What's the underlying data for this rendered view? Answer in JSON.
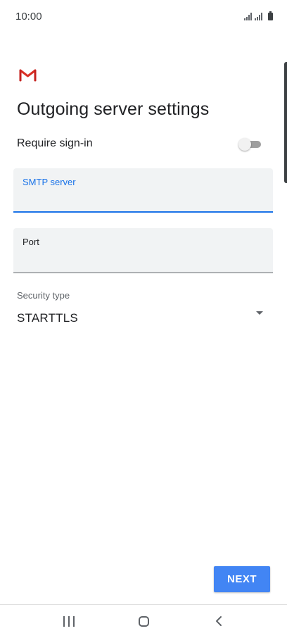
{
  "status_bar": {
    "time": "10:00",
    "icons": [
      "signal-icon",
      "signal-icon",
      "battery-icon"
    ]
  },
  "app": {
    "logo": "gmail-icon",
    "colors": {
      "accent": "#1a73e8",
      "button": "#4285f4",
      "gmail_red": "#d93025"
    }
  },
  "page": {
    "title": "Outgoing server settings"
  },
  "require_signin": {
    "label": "Require sign-in",
    "enabled": false
  },
  "smtp_field": {
    "label": "SMTP server",
    "value": "",
    "focused": true
  },
  "port_field": {
    "label": "Port",
    "value": ""
  },
  "security": {
    "label": "Security type",
    "value": "STARTTLS"
  },
  "actions": {
    "next_label": "NEXT"
  },
  "nav_bar": {
    "icons": [
      "recents-icon",
      "home-icon",
      "back-icon"
    ]
  }
}
